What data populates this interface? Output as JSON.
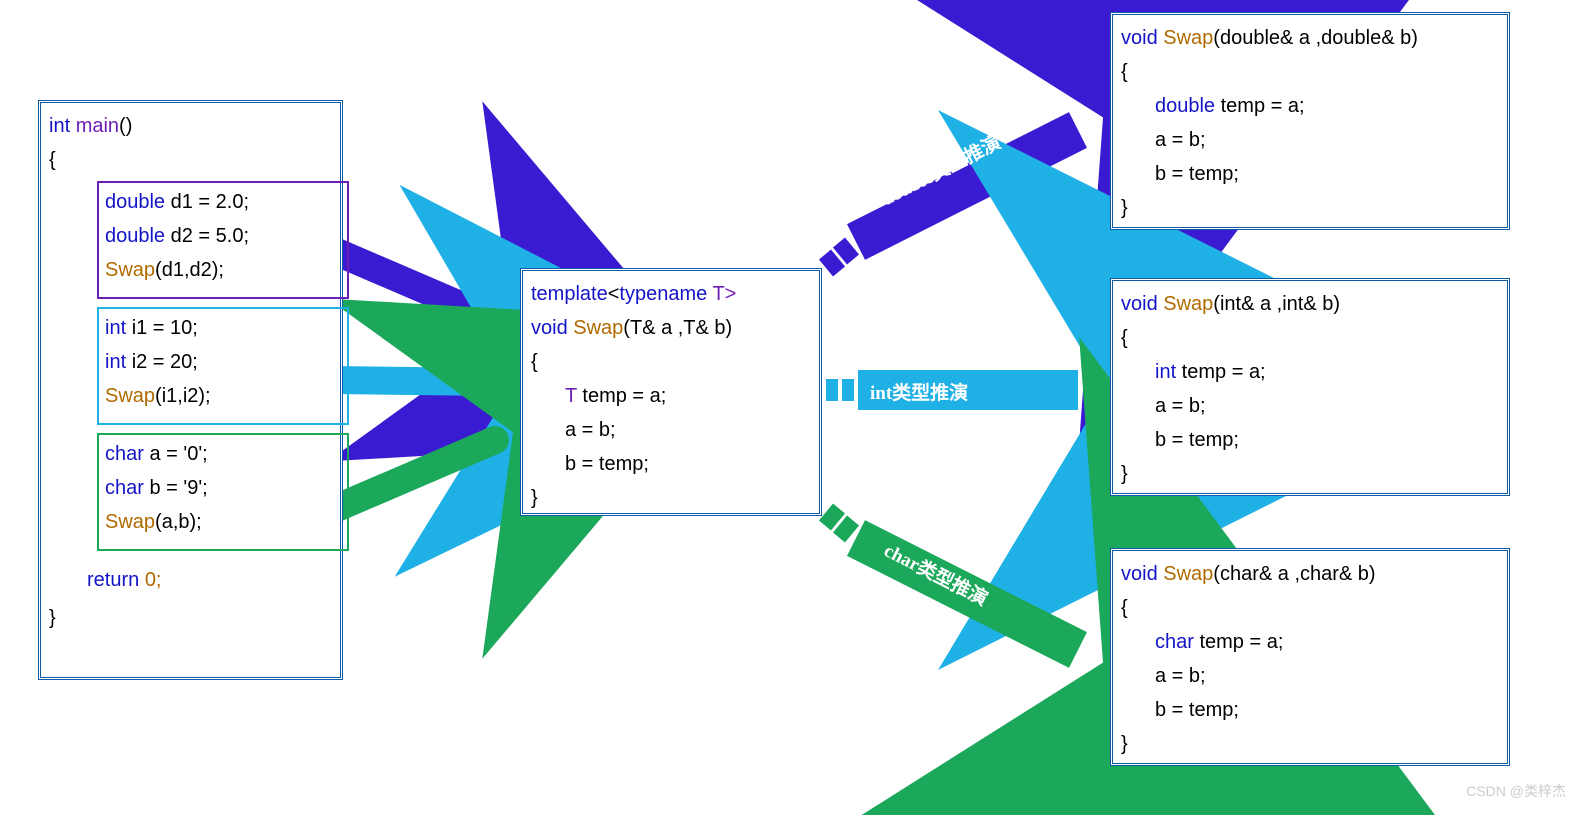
{
  "main": {
    "sig_ty": "int",
    "sig_name": "main",
    "sig_rest": "()",
    "d1": "d1 = 2.0;",
    "d2": "d2 = 5.0;",
    "swap_d": "(d1,d2);",
    "i1": "i1 = 10;",
    "i2": "i2 = 20;",
    "swap_i": "(i1,i2);",
    "ca": "a = '0';",
    "cb": "b = '9';",
    "swap_c": "(a,b);",
    "ret": "0;"
  },
  "tpl": {
    "l1a": "template",
    "l1b": "<",
    "l1c": "typename",
    "l1d": " T>",
    "sig_ty": "void",
    "sig_fn": "Swap",
    "sig_args": "(T& a ,T& b)",
    "body_t": "T",
    "body_t2": " temp = a;",
    "body_a": "a = b;",
    "body_b": "b = temp;"
  },
  "out_d": {
    "args": "(double& a ,double& b)",
    "t": "double",
    "t2": " temp = a;"
  },
  "out_i": {
    "args": "(int& a ,int& b)",
    "t": "int",
    "t2": " temp = a;"
  },
  "out_c": {
    "args": "(char& a ,char& b)",
    "t": "char",
    "t2": " temp = a;"
  },
  "arrows": {
    "double": "double类型推演",
    "int": "int类型推演",
    "char": "char类型推演"
  },
  "colors": {
    "purple": "#3a1bd1",
    "cyan": "#1fb0e6",
    "green": "#1ba85a"
  },
  "watermark": "CSDN @类梓杰"
}
